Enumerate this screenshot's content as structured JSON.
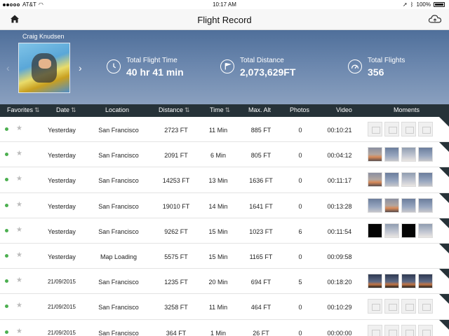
{
  "status_bar": {
    "carrier": "AT&T",
    "time": "10:17 AM",
    "battery": "100%"
  },
  "nav": {
    "title": "Flight Record"
  },
  "profile": {
    "name": "Craig Knudsen",
    "stats": [
      {
        "label": "Total Flight Time",
        "value": "40 hr 41 min",
        "icon": "clock-icon"
      },
      {
        "label": "Total Distance",
        "value": "2,073,629FT",
        "icon": "flag-icon"
      },
      {
        "label": "Total Flights",
        "value": "356",
        "icon": "gauge-icon"
      }
    ]
  },
  "columns": {
    "favorites": "Favorites",
    "date": "Date",
    "location": "Location",
    "distance": "Distance",
    "time": "Time",
    "max_alt": "Max. Alt",
    "photos": "Photos",
    "video": "Video",
    "moments": "Moments"
  },
  "rows": [
    {
      "date": "Yesterday",
      "location": "San Francisco",
      "distance": "2723 FT",
      "time": "11 Min",
      "max_alt": "885 FT",
      "photos": "0",
      "video": "00:10:21",
      "moments": [
        "empty",
        "empty",
        "empty",
        "empty"
      ]
    },
    {
      "date": "Yesterday",
      "location": "San Francisco",
      "distance": "2091 FT",
      "time": "6 Min",
      "max_alt": "805 FT",
      "photos": "0",
      "video": "00:04:12",
      "moments": [
        "sunset",
        "sky",
        "cloud",
        "sky"
      ]
    },
    {
      "date": "Yesterday",
      "location": "San Francisco",
      "distance": "14253 FT",
      "time": "13 Min",
      "max_alt": "1636 FT",
      "photos": "0",
      "video": "00:11:17",
      "moments": [
        "sunset",
        "sky",
        "cloud",
        "sky"
      ]
    },
    {
      "date": "Yesterday",
      "location": "San Francisco",
      "distance": "19010 FT",
      "time": "14 Min",
      "max_alt": "1641 FT",
      "photos": "0",
      "video": "00:13:28",
      "moments": [
        "sky",
        "sunset",
        "sky",
        "sky"
      ]
    },
    {
      "date": "Yesterday",
      "location": "San Francisco",
      "distance": "9262 FT",
      "time": "15 Min",
      "max_alt": "1023 FT",
      "photos": "6",
      "video": "00:11:54",
      "moments": [
        "dark",
        "cloud",
        "dark",
        "cloud"
      ]
    },
    {
      "date": "Yesterday",
      "location": "Map Loading",
      "distance": "5575 FT",
      "time": "15 Min",
      "max_alt": "1165 FT",
      "photos": "0",
      "video": "00:09:58",
      "moments": []
    },
    {
      "date": "21/09/2015",
      "location": "San Francisco",
      "distance": "1235 FT",
      "time": "20 Min",
      "max_alt": "694 FT",
      "photos": "5",
      "video": "00:18:20",
      "moments": [
        "dusk",
        "dusk",
        "dusk",
        "dusk"
      ]
    },
    {
      "date": "21/09/2015",
      "location": "San Francisco",
      "distance": "3258 FT",
      "time": "11 Min",
      "max_alt": "464 FT",
      "photos": "0",
      "video": "00:10:29",
      "moments": [
        "empty",
        "empty",
        "empty",
        "empty"
      ]
    },
    {
      "date": "21/09/2015",
      "location": "San Francisco",
      "distance": "364 FT",
      "time": "1 Min",
      "max_alt": "26 FT",
      "photos": "0",
      "video": "00:00:00",
      "moments": [
        "empty",
        "empty",
        "empty",
        "empty"
      ]
    }
  ]
}
